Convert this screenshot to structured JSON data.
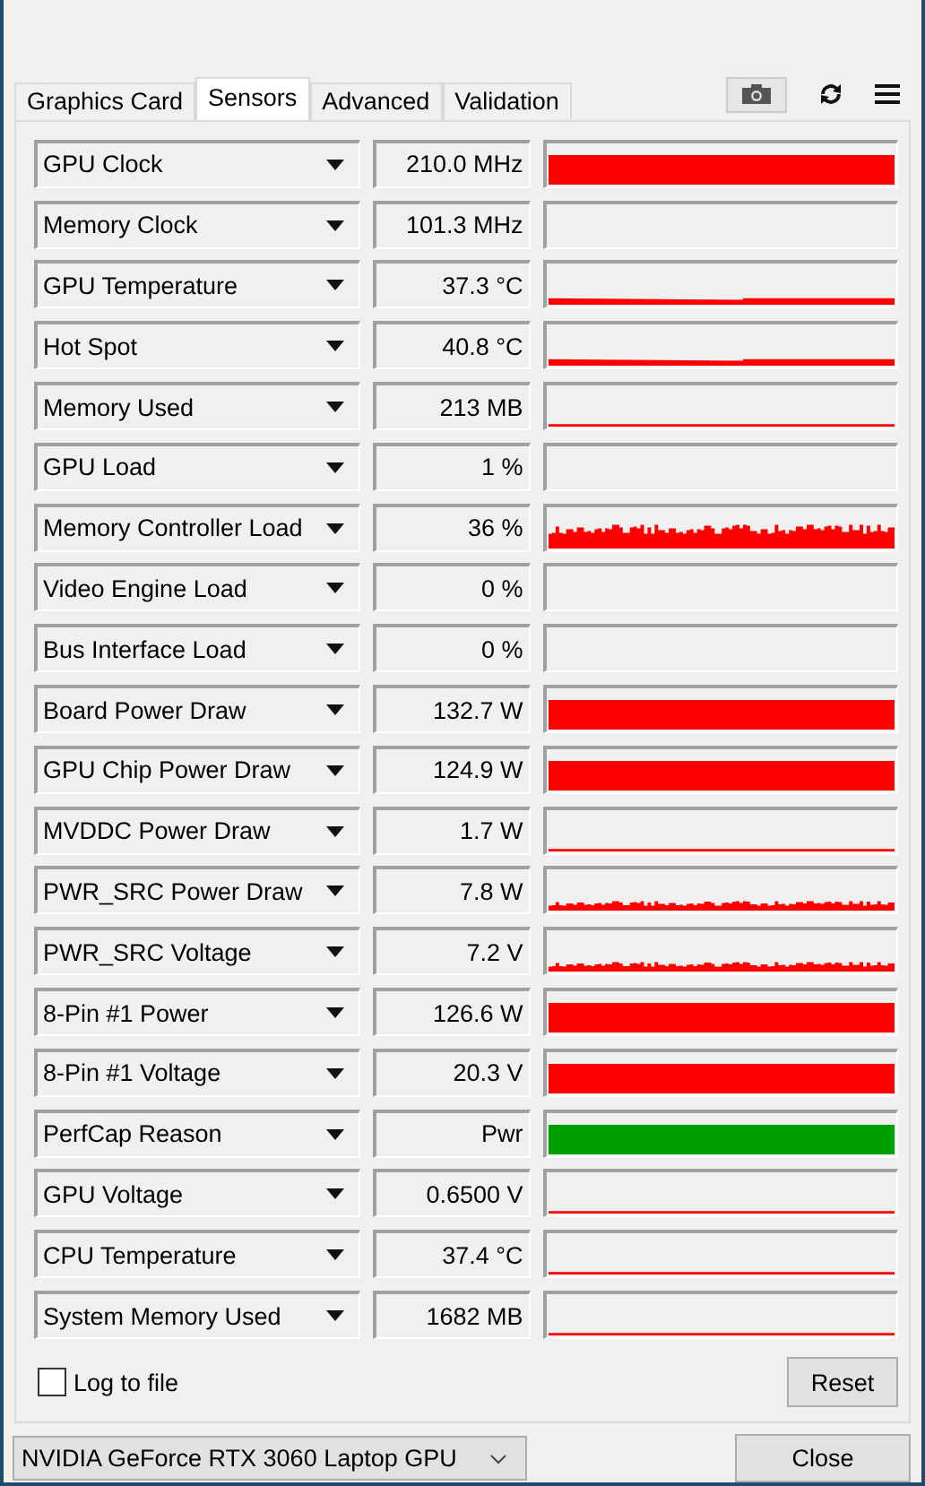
{
  "tabs": [
    {
      "label": "Graphics Card",
      "selected": false
    },
    {
      "label": "Sensors",
      "selected": true
    },
    {
      "label": "Advanced",
      "selected": false
    },
    {
      "label": "Validation",
      "selected": false
    }
  ],
  "sensors": [
    {
      "name": "GPU Clock",
      "value": "210.0 MHz",
      "kind": "full"
    },
    {
      "name": "Memory Clock",
      "value": "101.3 MHz",
      "kind": "empty"
    },
    {
      "name": "GPU Temperature",
      "value": "37.3 °C",
      "kind": "low"
    },
    {
      "name": "Hot Spot",
      "value": "40.8 °C",
      "kind": "low"
    },
    {
      "name": "Memory Used",
      "value": "213 MB",
      "kind": "line"
    },
    {
      "name": "GPU Load",
      "value": "1 %",
      "kind": "empty"
    },
    {
      "name": "Memory Controller Load",
      "value": "36 %",
      "kind": "noisy"
    },
    {
      "name": "Video Engine Load",
      "value": "0 %",
      "kind": "empty"
    },
    {
      "name": "Bus Interface Load",
      "value": "0 %",
      "kind": "empty"
    },
    {
      "name": "Board Power Draw",
      "value": "132.7 W",
      "kind": "full"
    },
    {
      "name": "GPU Chip Power Draw",
      "value": "124.9 W",
      "kind": "full"
    },
    {
      "name": "MVDDC Power Draw",
      "value": "1.7 W",
      "kind": "line"
    },
    {
      "name": "PWR_SRC Power Draw",
      "value": "7.8 W",
      "kind": "noisylow"
    },
    {
      "name": "PWR_SRC Voltage",
      "value": "7.2 V",
      "kind": "noisylow"
    },
    {
      "name": "8-Pin #1 Power",
      "value": "126.6 W",
      "kind": "full"
    },
    {
      "name": "8-Pin #1 Voltage",
      "value": "20.3 V",
      "kind": "full"
    },
    {
      "name": "PerfCap Reason",
      "value": "Pwr",
      "kind": "fullgreen"
    },
    {
      "name": "GPU Voltage",
      "value": "0.6500 V",
      "kind": "line"
    },
    {
      "name": "CPU Temperature",
      "value": "37.4 °C",
      "kind": "line"
    },
    {
      "name": "System Memory Used",
      "value": "1682 MB",
      "kind": "line"
    }
  ],
  "log_to_file": {
    "label": "Log to file",
    "checked": false
  },
  "reset_button": "Reset",
  "gpu_select": "NVIDIA GeForce RTX 3060 Laptop GPU",
  "close_button": "Close"
}
